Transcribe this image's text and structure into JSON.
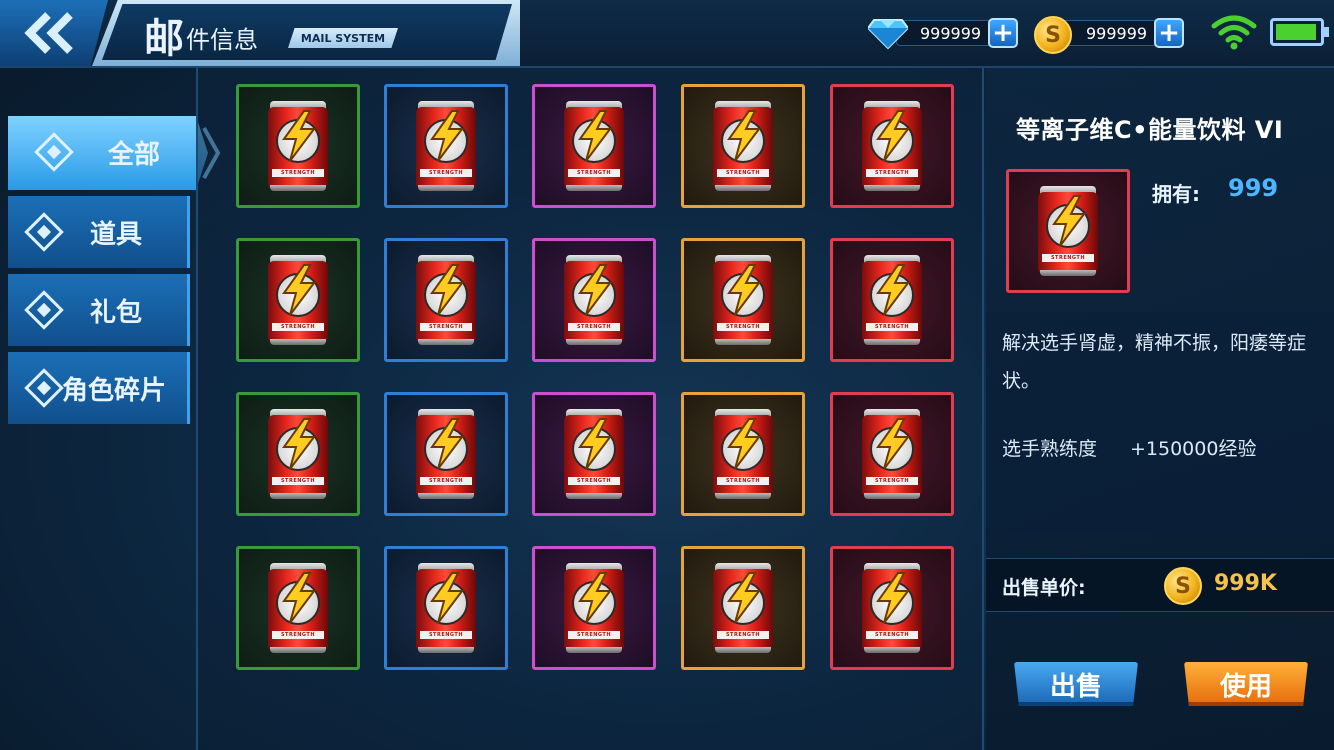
{
  "header": {
    "title_big": "邮",
    "title_rest": "件信息",
    "title_en": "MAIL SYSTEM",
    "gems": "999999",
    "coins": "999999",
    "coin_symbol": "S",
    "plus": "+"
  },
  "nav": {
    "items": [
      {
        "label": "全部",
        "active": true
      },
      {
        "label": "道具",
        "active": false
      },
      {
        "label": "礼包",
        "active": false
      },
      {
        "label": "角色碎片",
        "active": false
      }
    ]
  },
  "grid": {
    "rows": 4,
    "rarity_colors": [
      "green",
      "blue",
      "purple",
      "orange",
      "red"
    ],
    "item_icon": "energy-drink-can-icon",
    "can_label": "STRENGTH"
  },
  "detail": {
    "name": "等离子维C•能量饮料  VI",
    "own_label": "拥有:",
    "own_value": "999",
    "description": "解决选手肾虚，精神不振，阳痿等症状。",
    "exp_label": "选手熟练度",
    "exp_value": "+150000经验",
    "price_label": "出售单价:",
    "price_value": "999K",
    "sell_label": "出售",
    "use_label": "使用"
  },
  "colors": {
    "accent_blue": "#2a9ae7",
    "own_value": "#4cb6ff",
    "price": "#f6c34a",
    "sell_button": "#1966b3",
    "use_button": "#e56b0a"
  }
}
